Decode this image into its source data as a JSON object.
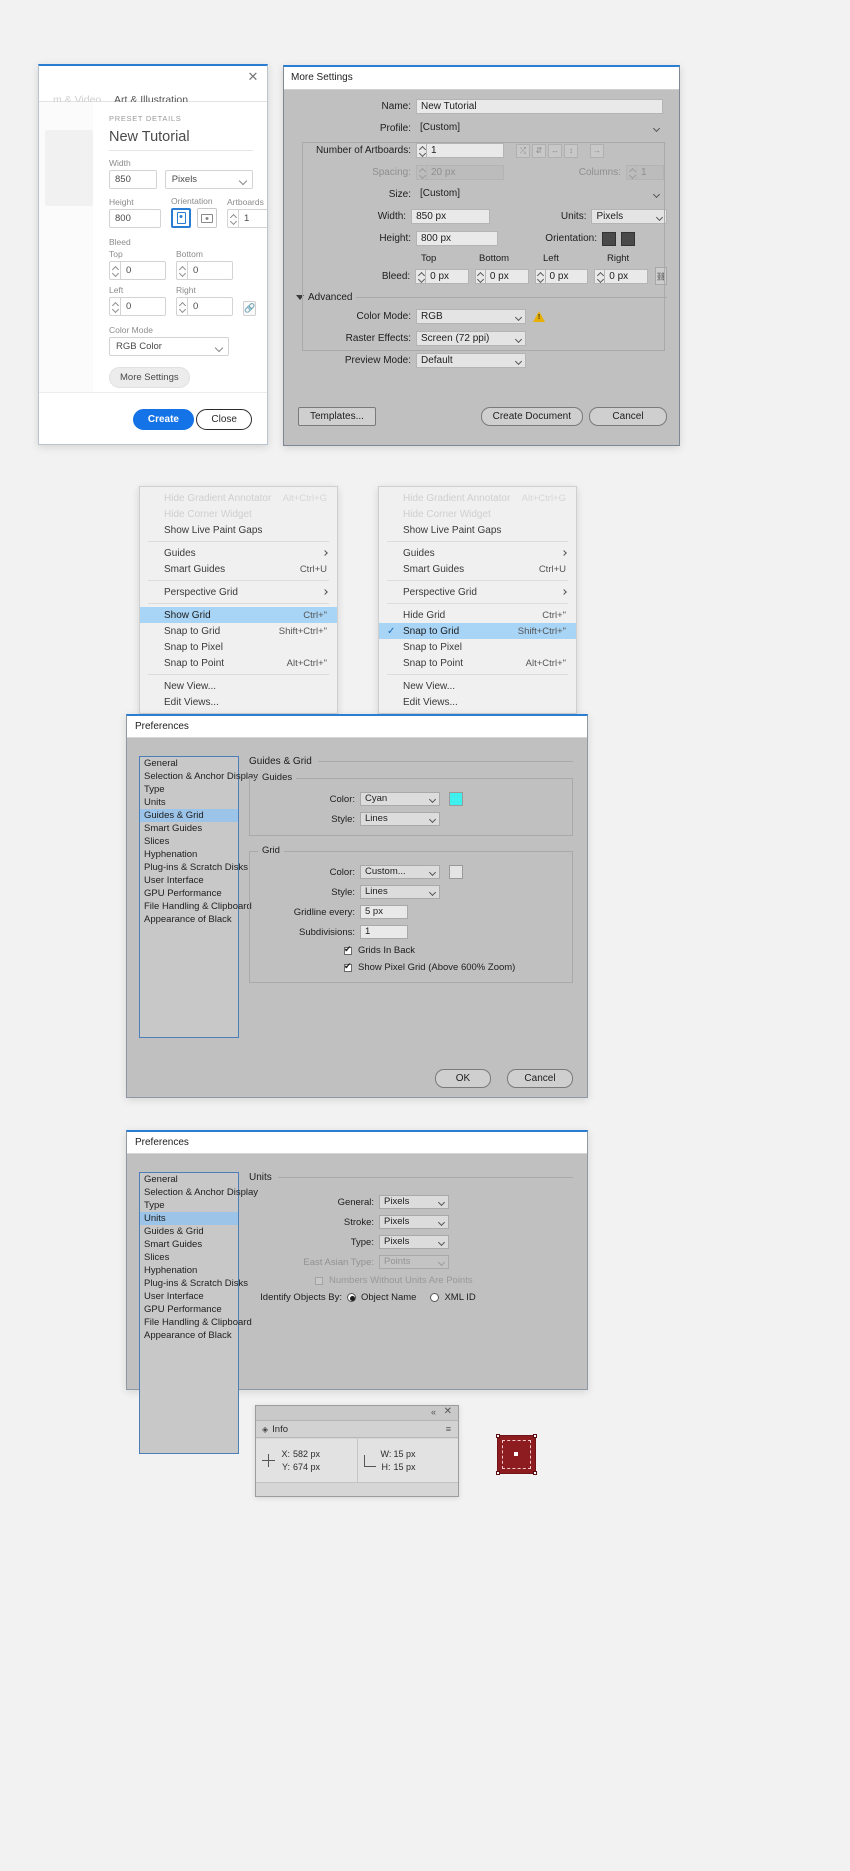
{
  "new_document": {
    "close_icon": "close-icon",
    "tabs": [
      {
        "label": "m & Video",
        "state": "dimmed"
      },
      {
        "label": "Art & Illustration",
        "state": "active"
      }
    ],
    "preset_caption": "PRESET DETAILS",
    "preset_name": "New Tutorial",
    "width_label": "Width",
    "width_value": "850",
    "width_units": "Pixels",
    "height_label": "Height",
    "height_value": "800",
    "orientation_label": "Orientation",
    "artboards_label": "Artboards",
    "artboards_value": "1",
    "bleed_label": "Bleed",
    "bleed": {
      "top_label": "Top",
      "top_value": "0",
      "bottom_label": "Bottom",
      "bottom_value": "0",
      "left_label": "Left",
      "left_value": "0",
      "right_label": "Right",
      "right_value": "0",
      "link_icon": "link-icon"
    },
    "color_mode_label": "Color Mode",
    "color_mode_value": "RGB Color",
    "more_settings_label": "More Settings",
    "create_label": "Create",
    "close_label": "Close",
    "accent_color": "#1473e6"
  },
  "more_settings": {
    "title": "More Settings",
    "name_label": "Name:",
    "name_value": "New Tutorial",
    "profile_label": "Profile:",
    "profile_value": "[Custom]",
    "artboards_label": "Number of Artboards:",
    "artboards_value": "1",
    "arrange_icons": [
      "grid-by-row-icon",
      "grid-by-column-icon",
      "arrange-by-row-icon",
      "arrange-by-column-icon"
    ],
    "direction_icon": "arrow-right-icon",
    "spacing_label": "Spacing:",
    "spacing_value": "20 px",
    "columns_label": "Columns:",
    "columns_value": "1",
    "size_label": "Size:",
    "size_value": "[Custom]",
    "width_label": "Width:",
    "width_value": "850 px",
    "units_label": "Units:",
    "units_value": "Pixels",
    "height_label": "Height:",
    "height_value": "800 px",
    "orientation_label": "Orientation:",
    "bleed_label": "Bleed:",
    "bleed_top_label": "Top",
    "bleed_top_value": "0 px",
    "bleed_bottom_label": "Bottom",
    "bleed_bottom_value": "0 px",
    "bleed_left_label": "Left",
    "bleed_left_value": "0 px",
    "bleed_right_label": "Right",
    "bleed_right_value": "0 px",
    "bleed_link_icon": "link-icon",
    "advanced_label": "Advanced",
    "color_mode_label": "Color Mode:",
    "color_mode_value": "RGB",
    "warning_icon": "warning-icon",
    "warning_glyph": "!",
    "raster_label": "Raster Effects:",
    "raster_value": "Screen (72 ppi)",
    "preview_label": "Preview Mode:",
    "preview_value": "Default",
    "templates_label": "Templates...",
    "create_document_label": "Create Document",
    "cancel_label": "Cancel"
  },
  "menu_left": {
    "items": [
      {
        "label": "Hide Gradient Annotator",
        "shortcut": "Alt+Ctrl+G",
        "state": "dimmed"
      },
      {
        "label": "Hide Corner Widget",
        "shortcut": "",
        "state": "dimmed"
      },
      {
        "label": "Show Live Paint Gaps",
        "shortcut": "",
        "state": "normal"
      },
      {
        "label": "__sep__"
      },
      {
        "label": "Guides",
        "shortcut": "",
        "state": "submenu"
      },
      {
        "label": "Smart Guides",
        "shortcut": "Ctrl+U",
        "state": "normal"
      },
      {
        "label": "__sep__"
      },
      {
        "label": "Perspective Grid",
        "shortcut": "",
        "state": "submenu"
      },
      {
        "label": "__sep__"
      },
      {
        "label": "Show Grid",
        "shortcut": "Ctrl+\"",
        "state": "highlight"
      },
      {
        "label": "Snap to Grid",
        "shortcut": "Shift+Ctrl+\"",
        "state": "normal"
      },
      {
        "label": "Snap to Pixel",
        "shortcut": "",
        "state": "normal"
      },
      {
        "label": "Snap to Point",
        "shortcut": "Alt+Ctrl+\"",
        "state": "normal"
      },
      {
        "label": "__sep__"
      },
      {
        "label": "New View...",
        "shortcut": "",
        "state": "normal"
      },
      {
        "label": "Edit Views...",
        "shortcut": "",
        "state": "normal"
      }
    ]
  },
  "menu_right": {
    "items": [
      {
        "label": "Hide Gradient Annotator",
        "shortcut": "Alt+Ctrl+G",
        "state": "dimmed"
      },
      {
        "label": "Hide Corner Widget",
        "shortcut": "",
        "state": "dimmed"
      },
      {
        "label": "Show Live Paint Gaps",
        "shortcut": "",
        "state": "normal"
      },
      {
        "label": "__sep__"
      },
      {
        "label": "Guides",
        "shortcut": "",
        "state": "submenu"
      },
      {
        "label": "Smart Guides",
        "shortcut": "Ctrl+U",
        "state": "normal"
      },
      {
        "label": "__sep__"
      },
      {
        "label": "Perspective Grid",
        "shortcut": "",
        "state": "submenu"
      },
      {
        "label": "__sep__"
      },
      {
        "label": "Hide Grid",
        "shortcut": "Ctrl+\"",
        "state": "normal"
      },
      {
        "label": "Snap to Grid",
        "shortcut": "Shift+Ctrl+\"",
        "state": "highlight-checked"
      },
      {
        "label": "Snap to Pixel",
        "shortcut": "",
        "state": "normal"
      },
      {
        "label": "Snap to Point",
        "shortcut": "Alt+Ctrl+\"",
        "state": "normal"
      },
      {
        "label": "__sep__"
      },
      {
        "label": "New View...",
        "shortcut": "",
        "state": "normal"
      },
      {
        "label": "Edit Views...",
        "shortcut": "",
        "state": "normal"
      }
    ],
    "check_glyph": "✓"
  },
  "prefs_grid": {
    "title": "Preferences",
    "categories": [
      "General",
      "Selection & Anchor Display",
      "Type",
      "Units",
      "Guides & Grid",
      "Smart Guides",
      "Slices",
      "Hyphenation",
      "Plug-ins & Scratch Disks",
      "User Interface",
      "GPU Performance",
      "File Handling & Clipboard",
      "Appearance of Black"
    ],
    "selected_category": "Guides & Grid",
    "pane_title": "Guides & Grid",
    "guides_legend": "Guides",
    "guides_color_label": "Color:",
    "guides_color_value": "Cyan",
    "guides_color_swatch": "#3ff0ee",
    "guides_style_label": "Style:",
    "guides_style_value": "Lines",
    "grid_legend": "Grid",
    "grid_color_label": "Color:",
    "grid_color_value": "Custom...",
    "grid_color_swatch": "#e3e3e3",
    "grid_style_label": "Style:",
    "grid_style_value": "Lines",
    "gridline_label": "Gridline every:",
    "gridline_value": "5 px",
    "subdivisions_label": "Subdivisions:",
    "subdivisions_value": "1",
    "grids_in_back_label": "Grids In Back",
    "grids_in_back_checked": true,
    "pixel_grid_label": "Show Pixel Grid (Above 600% Zoom)",
    "pixel_grid_checked": true,
    "ok_label": "OK",
    "cancel_label": "Cancel"
  },
  "prefs_units": {
    "title": "Preferences",
    "categories": [
      "General",
      "Selection & Anchor Display",
      "Type",
      "Units",
      "Guides & Grid",
      "Smart Guides",
      "Slices",
      "Hyphenation",
      "Plug-ins & Scratch Disks",
      "User Interface",
      "GPU Performance",
      "File Handling & Clipboard",
      "Appearance of Black"
    ],
    "selected_category": "Units",
    "pane_title": "Units",
    "general_label": "General:",
    "general_value": "Pixels",
    "stroke_label": "Stroke:",
    "stroke_value": "Pixels",
    "type_label": "Type:",
    "type_value": "Pixels",
    "east_asian_label": "East Asian Type:",
    "east_asian_value": "Points",
    "numbers_label": "Numbers Without Units Are Points",
    "identify_label": "Identify Objects By:",
    "object_name_label": "Object Name",
    "xml_id_label": "XML ID",
    "identify_selected": "Object Name"
  },
  "info_panel": {
    "tab_label": "Info",
    "collapse_icon": "chevron-double-up-icon",
    "close_icon": "close-icon",
    "menu_icon": "panel-menu-icon",
    "crosshair_icon": "crosshair-icon",
    "size-icon": "size-icon",
    "x_label": "X:",
    "x_value": "582 px",
    "y_label": "Y:",
    "y_value": "674 px",
    "w_label": "W:",
    "w_value": "15 px",
    "h_label": "H:",
    "h_value": "15 px"
  },
  "artwork": {
    "name": "selected-square-artwork",
    "fill_color": "#8c1c20"
  }
}
